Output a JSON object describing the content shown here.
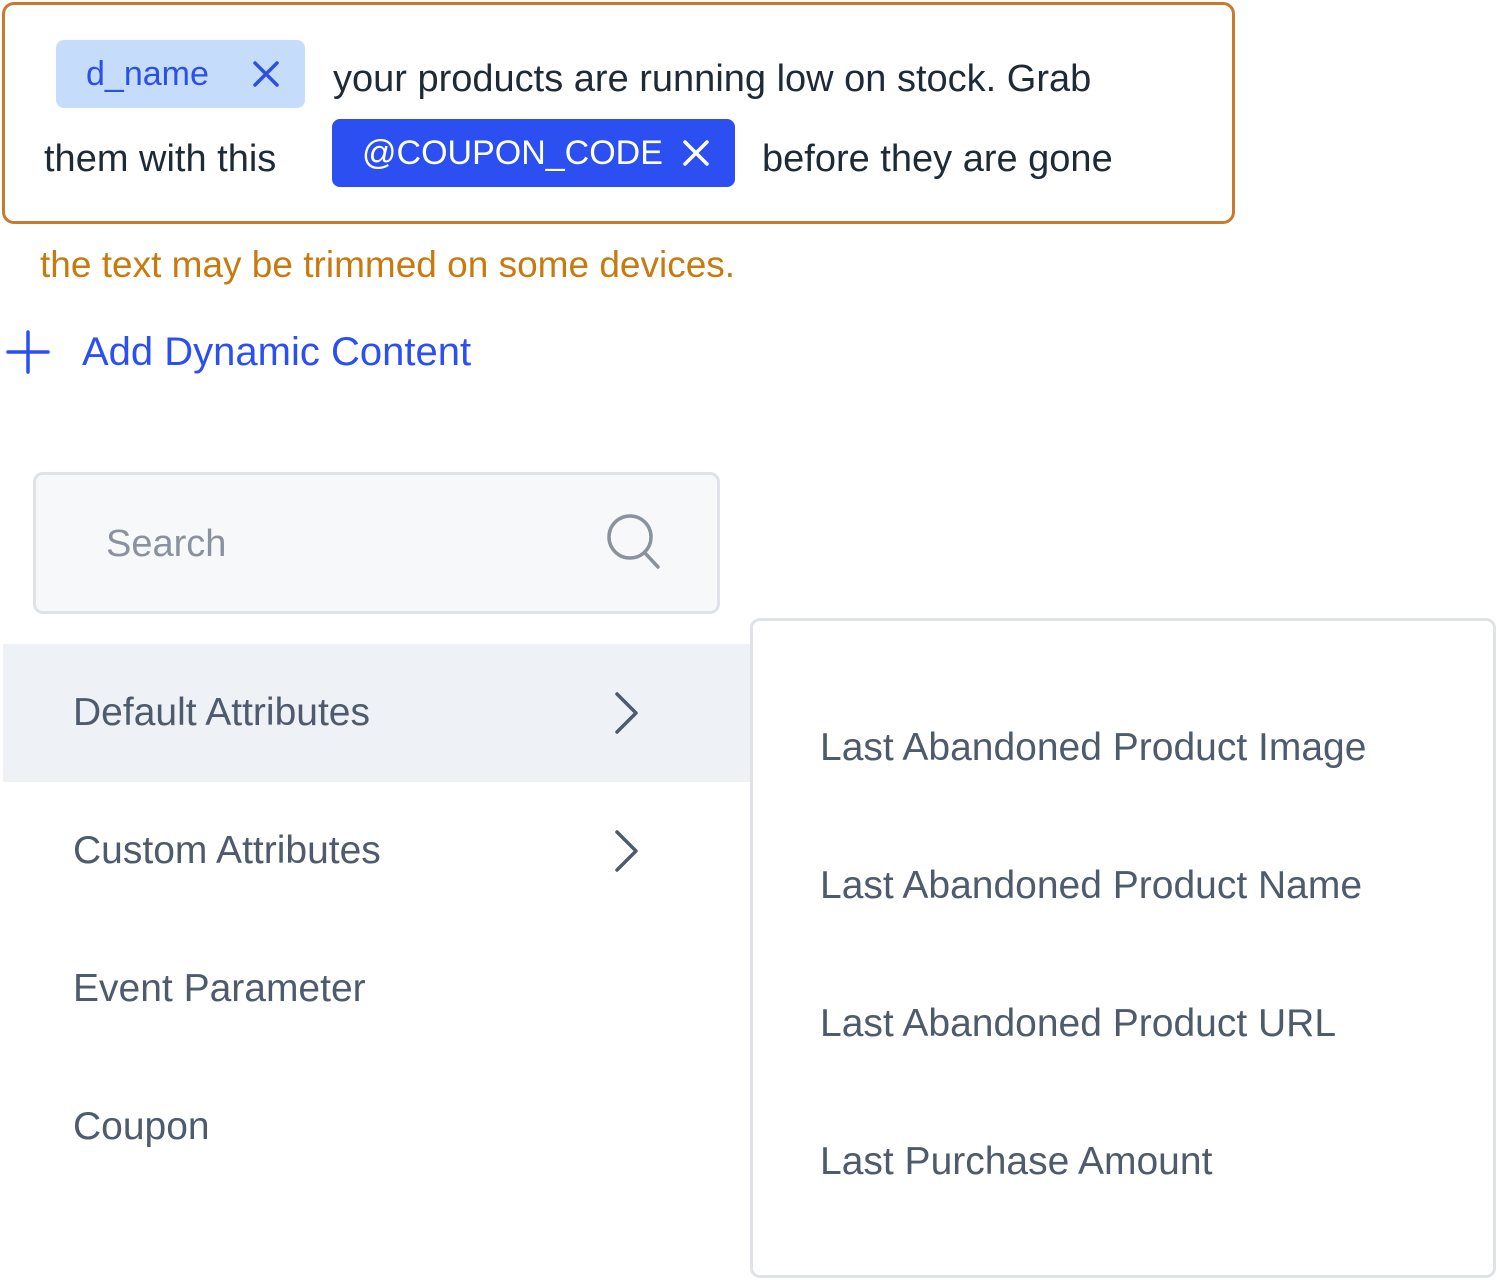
{
  "editor": {
    "chip_name": "d_name",
    "text_1": "your products are running low on stock. Grab",
    "text_2": "them with this",
    "chip_coupon": "@COUPON_CODE",
    "text_3": "before they are gone"
  },
  "warning": "the text may be trimmed on some devices.",
  "add_dynamic_label": "Add Dynamic Content",
  "search": {
    "placeholder": "Search",
    "value": ""
  },
  "categories": [
    {
      "label": "Default Attributes",
      "has_submenu": true,
      "active": true
    },
    {
      "label": "Custom Attributes",
      "has_submenu": true,
      "active": false
    },
    {
      "label": "Event Parameter",
      "has_submenu": false,
      "active": false
    },
    {
      "label": "Coupon",
      "has_submenu": false,
      "active": false
    }
  ],
  "submenu_items": [
    "Last Abandoned Product Image",
    "Last Abandoned Product Name",
    "Last Abandoned Product URL",
    "Last Purchase Amount"
  ],
  "colors": {
    "warning_border": "#c97a2c",
    "accent": "#2b4ff0",
    "chip_light": "#c5dcfb"
  },
  "icons": [
    "close-icon",
    "plus-icon",
    "search-icon",
    "chevron-right-icon"
  ]
}
